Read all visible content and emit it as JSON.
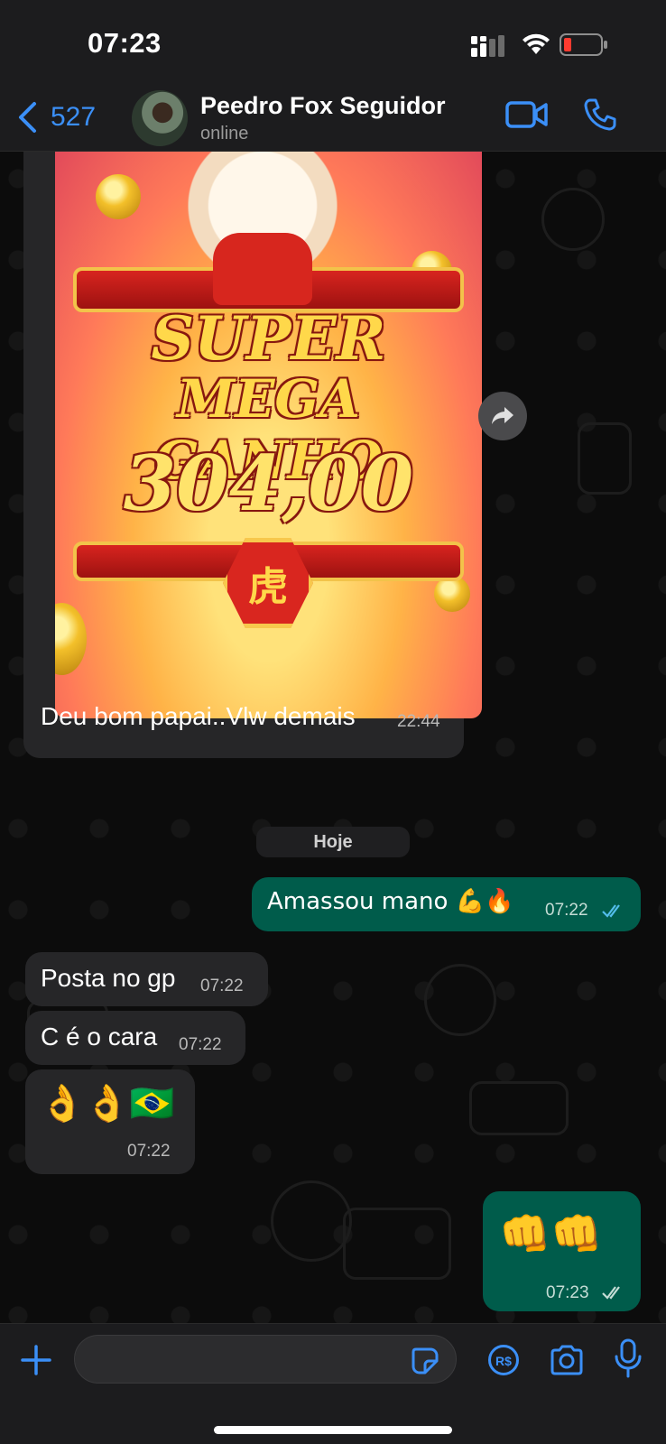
{
  "status_bar": {
    "time": "07:23"
  },
  "header": {
    "back_count": "527",
    "contact_name": "Peedro Fox Seguidor",
    "contact_status": "online"
  },
  "game_image": {
    "line1": "SUPER",
    "line2": "MEGA GANHO",
    "amount": "304,00",
    "emblem_glyph": "虎"
  },
  "messages": [
    {
      "direction": "in",
      "text": "Deu bom papai..Vlw demais",
      "time": "22:44"
    },
    {
      "direction": "out",
      "text": "Amassou mano 💪🔥",
      "time": "07:22",
      "status": "read"
    },
    {
      "direction": "in",
      "text": "Posta no gp",
      "time": "07:22"
    },
    {
      "direction": "in",
      "text": "C é o cara",
      "time": "07:22"
    },
    {
      "direction": "in",
      "text": "👌👌🇧🇷",
      "time": "07:22"
    },
    {
      "direction": "out",
      "text": "👊👊",
      "time": "07:23",
      "status": "delivered"
    }
  ],
  "date_divider": "Hoje",
  "input": {
    "placeholder": ""
  },
  "colors": {
    "accent": "#3b8ff7",
    "outgoing_bubble": "#005c4b",
    "incoming_bubble": "#262628"
  },
  "icons": [
    "back-chevron-icon",
    "video-call-icon",
    "phone-call-icon",
    "forward-icon",
    "plus-icon",
    "sticker-icon",
    "pix-payment-icon",
    "camera-icon",
    "microphone-icon"
  ]
}
